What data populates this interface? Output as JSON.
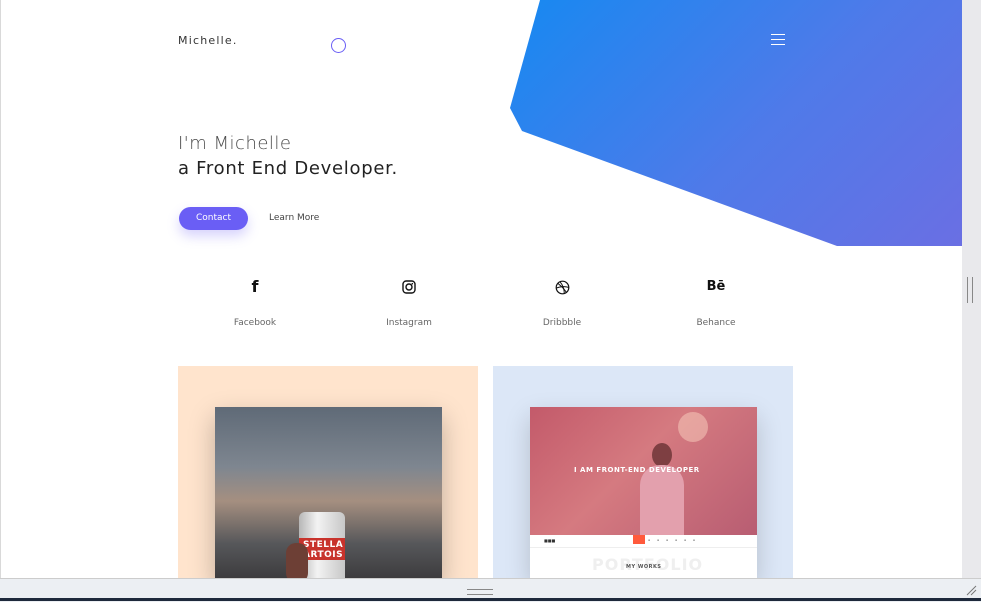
{
  "header": {
    "brand": "Michelle."
  },
  "hero": {
    "line1": "I'm Michelle",
    "line2": "a Front End Developer.",
    "contact_label": "Contact",
    "learn_label": "Learn More"
  },
  "social": [
    {
      "label": "Facebook",
      "icon": "facebook-icon"
    },
    {
      "label": "Instagram",
      "icon": "instagram-icon"
    },
    {
      "label": "Dribbble",
      "icon": "dribbble-icon"
    },
    {
      "label": "Behance",
      "icon": "behance-icon"
    }
  ],
  "icons": {
    "behance_glyph": "Bē",
    "facebook_glyph": "f"
  },
  "projects": [
    {
      "name": "photo-project",
      "can_text": "STELLA ARTOIS"
    },
    {
      "name": "portfolio-project",
      "hero_title": "I AM FRONT-END DEVELOPER",
      "section_bg_text": "PORTFOLIO",
      "section_label": "MY WORKS"
    }
  ],
  "colors": {
    "accent": "#6a5ef5",
    "gradient_start": "#1689f1",
    "gradient_end": "#6a6fe3",
    "card_warm": "#ffe4cd",
    "card_cool": "#dce7f7"
  }
}
